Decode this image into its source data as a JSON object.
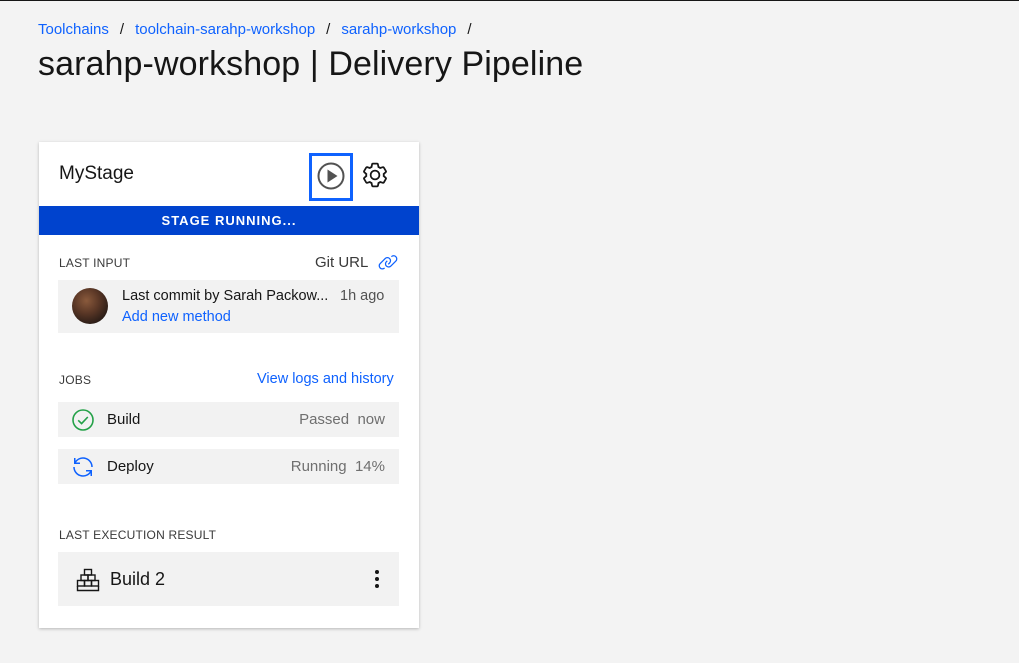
{
  "breadcrumb": [
    {
      "label": "Toolchains"
    },
    {
      "label": "toolchain-sarahp-workshop"
    },
    {
      "label": "sarahp-workshop"
    }
  ],
  "breadcrumb_separator": "/",
  "page_title": "sarahp-workshop | Delivery Pipeline",
  "stage": {
    "name": "MyStage",
    "status": "STAGE RUNNING...",
    "status_color": "#0043ce",
    "run_icon": "play-circle-icon",
    "settings_icon": "gear-icon",
    "last_input": {
      "label": "LAST INPUT",
      "source_label": "Git URL",
      "source_icon": "link-icon",
      "commit_text": "Last commit by Sarah Packow...",
      "commit_time": "1h ago",
      "commit_message": "Add new method"
    },
    "jobs": {
      "label": "JOBS",
      "view_logs_label": "View logs and history",
      "items": [
        {
          "name": "Build",
          "status": "Passed",
          "time": "now",
          "icon": "checkmark-circle-icon",
          "color": "#24a148"
        },
        {
          "name": "Deploy",
          "status": "Running",
          "progress": "14%",
          "icon": "renew-icon",
          "color": "#0f62fe"
        }
      ]
    },
    "last_execution": {
      "label": "LAST EXECUTION RESULT",
      "build_label": "Build 2",
      "build_icon": "build-blocks-icon",
      "menu_icon": "overflow-menu-icon"
    }
  },
  "colors": {
    "link": "#0f62fe",
    "accent": "#0f62fe",
    "background": "#f3f3f3"
  }
}
